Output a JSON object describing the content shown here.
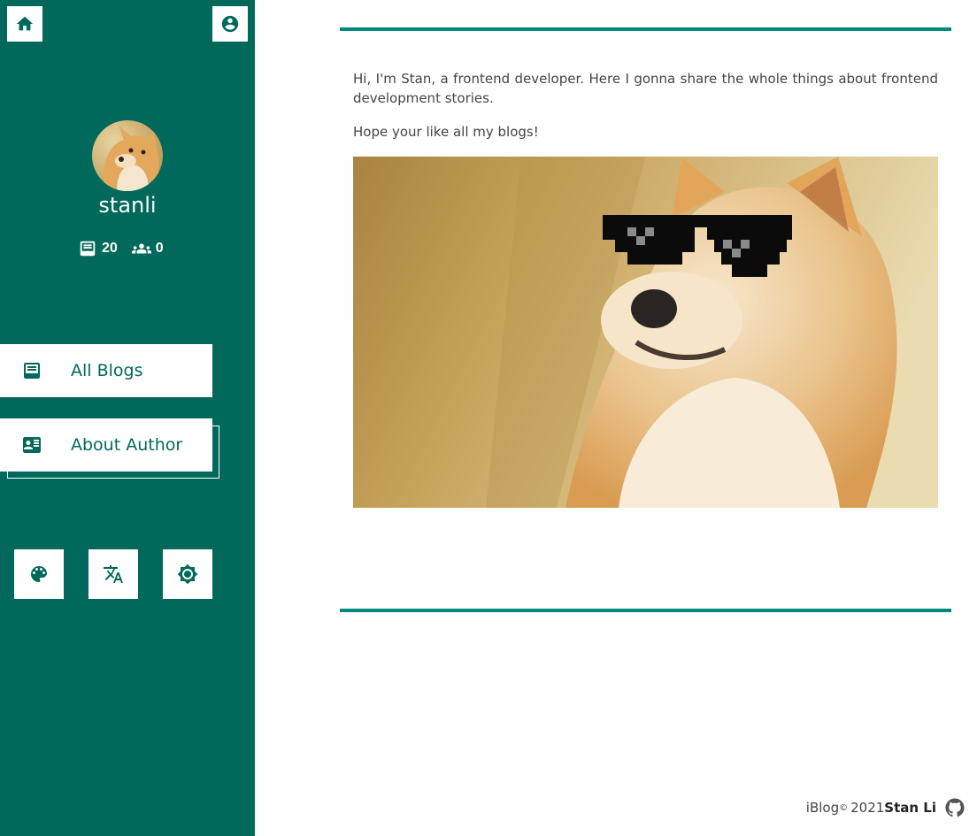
{
  "sidebar": {
    "username": "stanli",
    "stats": {
      "blogs_count": "20",
      "followers_count": "0"
    },
    "nav": [
      {
        "label": "All Blogs",
        "icon": "blog-icon"
      },
      {
        "label": "About Author",
        "icon": "contact-card-icon"
      }
    ],
    "top_buttons": [
      "home-icon",
      "account-circle-icon"
    ],
    "tools": [
      "palette-icon",
      "translate-icon",
      "brightness-icon"
    ]
  },
  "main": {
    "intro_text": "Hi, I'm Stan, a frontend developer. Here I gonna share the whole things about frontend development stories.",
    "hope_text": "Hope your like all my blogs!"
  },
  "footer": {
    "brand": "iBlog",
    "copyright_symbol": "©",
    "year": "2021",
    "author": "Stan Li",
    "icon": "github-icon"
  },
  "colors": {
    "sidebar_bg": "#00695c",
    "accent_rule": "#00897b",
    "text": "#444444"
  }
}
